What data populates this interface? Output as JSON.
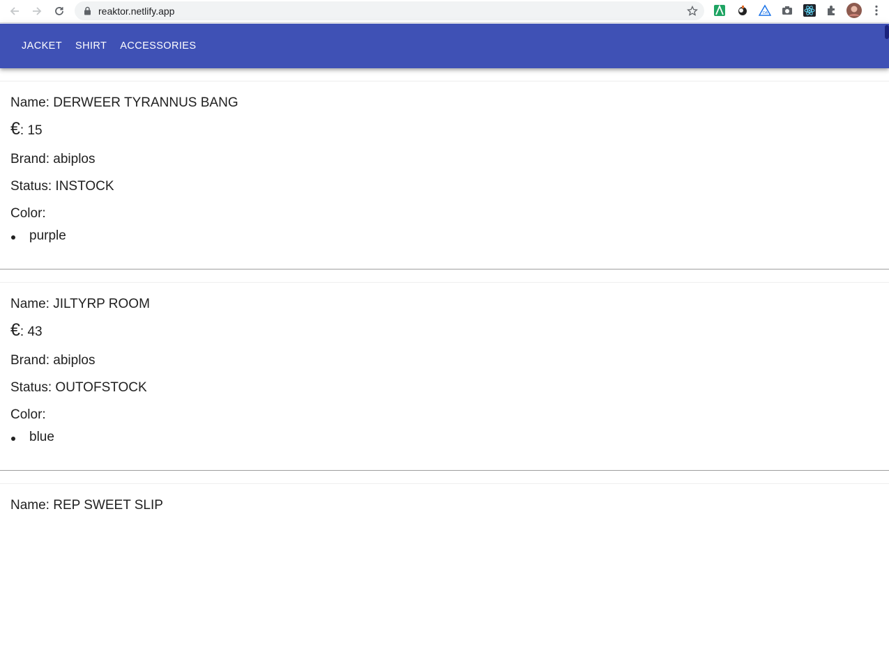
{
  "browser": {
    "url": "reaktor.netlify.app"
  },
  "nav": {
    "tabs": [
      {
        "label": "JACKET"
      },
      {
        "label": "SHIRT"
      },
      {
        "label": "ACCESSORIES"
      }
    ]
  },
  "labels": {
    "name": "Name: ",
    "price_symbol": "€",
    "price_sep": ": ",
    "brand": "Brand: ",
    "status": "Status: ",
    "color": "Color:"
  },
  "products": [
    {
      "name": "DERWEER TYRANNUS BANG",
      "price": "15",
      "brand": "abiplos",
      "status": "INSTOCK",
      "colors": [
        "purple"
      ]
    },
    {
      "name": "JILTYRP ROOM",
      "price": "43",
      "brand": "abiplos",
      "status": "OUTOFSTOCK",
      "colors": [
        "blue"
      ]
    },
    {
      "name": "REP SWEET SLIP"
    }
  ],
  "colors": {
    "app_bar": "#3f51b5",
    "text": "#212121"
  }
}
